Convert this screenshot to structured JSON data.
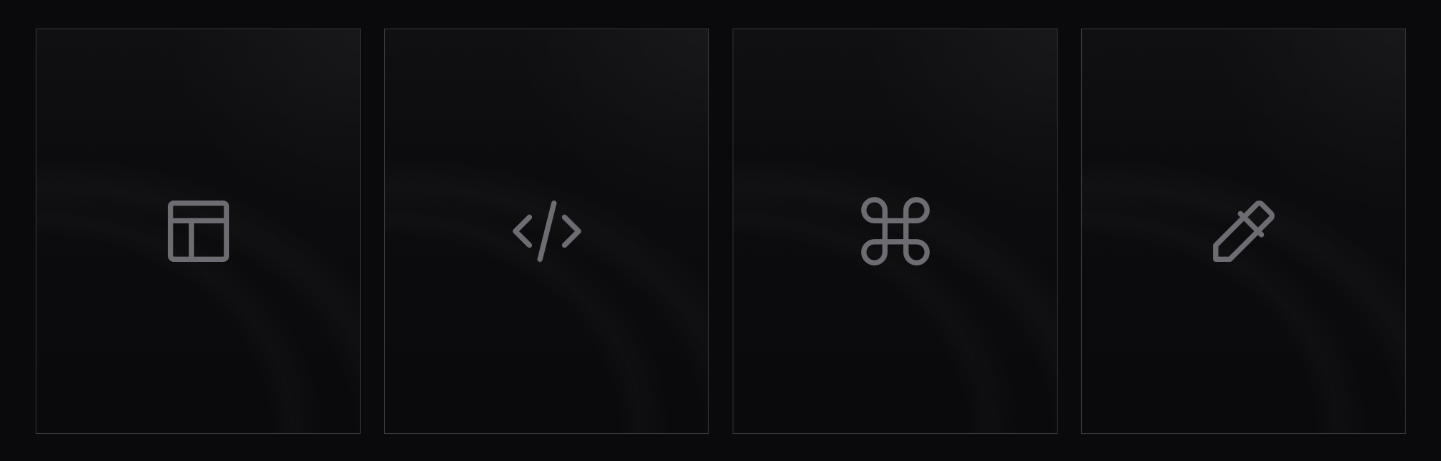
{
  "cards": [
    {
      "icon": "layout-template-icon"
    },
    {
      "icon": "code-icon"
    },
    {
      "icon": "command-icon"
    },
    {
      "icon": "eyedropper-icon"
    }
  ],
  "colors": {
    "background": "#0a0a0c",
    "card_border": "#3a3a3f",
    "icon_stroke": "#6c6c72"
  }
}
